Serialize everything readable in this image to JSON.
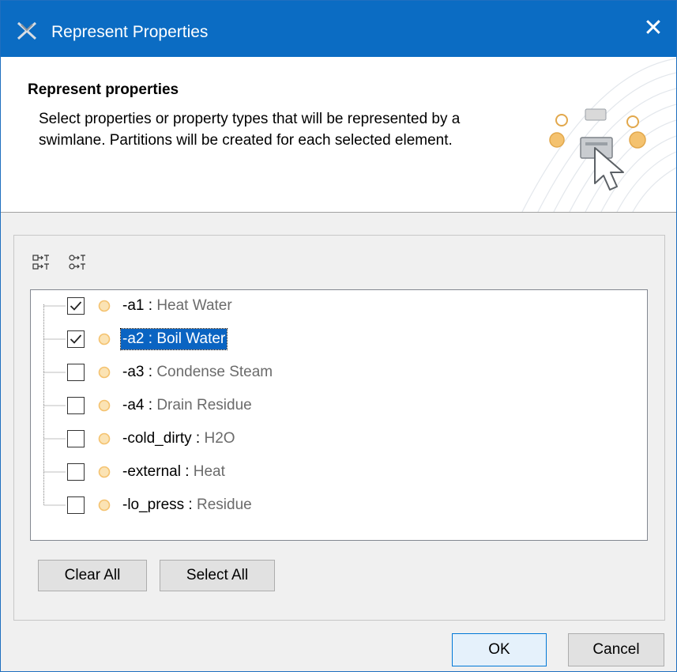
{
  "window": {
    "title": "Represent Properties",
    "close_glyph": "✕",
    "icon": "magicdraw-app-icon",
    "titlebar_color": "#0b6cc3"
  },
  "header": {
    "title": "Represent properties",
    "description": "Select properties or property types that will be represented by a swimlane. Partitions will be created for each selected element.",
    "illustration": "swimlane-cursor-illustration-icon"
  },
  "toolbar": {
    "buttons": [
      {
        "icon": "property-types-icon"
      },
      {
        "icon": "properties-icon"
      }
    ]
  },
  "tree": {
    "items": [
      {
        "name": "-a1",
        "sep": " : ",
        "type": "Heat Water",
        "checked": true,
        "selected": false
      },
      {
        "name": "-a2",
        "sep": " : ",
        "type": "Boil Water",
        "checked": true,
        "selected": true
      },
      {
        "name": "-a3",
        "sep": " : ",
        "type": "Condense Steam",
        "checked": false,
        "selected": false
      },
      {
        "name": "-a4",
        "sep": " : ",
        "type": "Drain Residue",
        "checked": false,
        "selected": false
      },
      {
        "name": "-cold_dirty",
        "sep": " : ",
        "type": "H2O",
        "checked": false,
        "selected": false
      },
      {
        "name": "-external",
        "sep": " : ",
        "type": "Heat",
        "checked": false,
        "selected": false
      },
      {
        "name": "-lo_press",
        "sep": " : ",
        "type": "Residue",
        "checked": false,
        "selected": false
      }
    ]
  },
  "buttons": {
    "clear_all": "Clear All",
    "select_all": "Select All",
    "ok": "OK",
    "cancel": "Cancel"
  },
  "colors": {
    "selection": "#0a64c2",
    "property_icon": "#f4c26f"
  }
}
